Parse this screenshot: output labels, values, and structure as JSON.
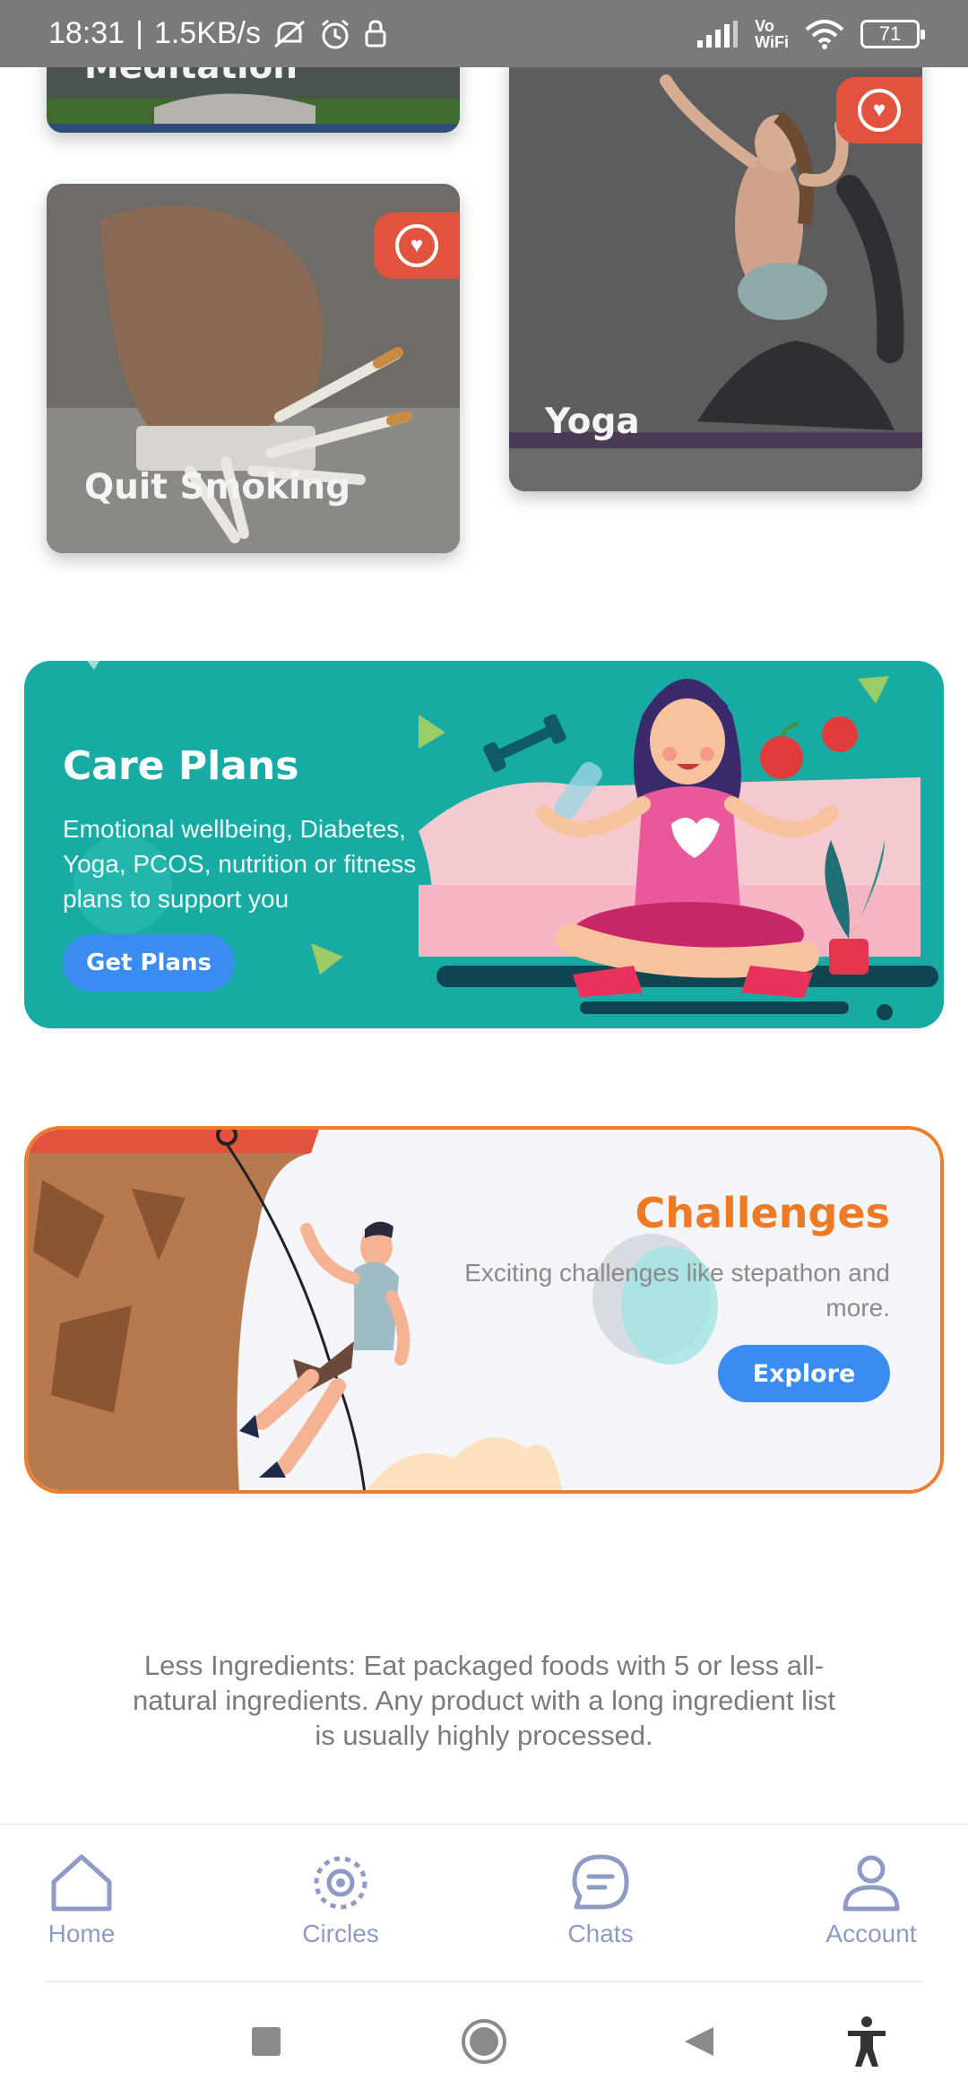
{
  "status_bar": {
    "time": "18:31",
    "net_speed": "1.5KB/s",
    "vowifi_top": "Vo",
    "vowifi_bottom": "WiFi",
    "battery": "71"
  },
  "cards": [
    {
      "label": "Meditation",
      "liked": true
    },
    {
      "label": "Quit Smoking",
      "liked": true
    },
    {
      "label": "Yoga",
      "liked": true
    }
  ],
  "care_plans": {
    "title": "Care Plans",
    "description": "Emotional wellbeing, Diabetes, Yoga, PCOS, nutrition or fitness plans to support you",
    "button": "Get Plans",
    "color": "#17aba4"
  },
  "challenges": {
    "title": "Challenges",
    "description": "Exciting challenges like stepathon and more.",
    "button": "Explore",
    "accent": "#ef7d2d"
  },
  "tip": "Less Ingredients: Eat packaged foods with 5 or less all-natural ingredients. Any product with a long ingredient list is usually highly processed.",
  "bottom_nav": [
    {
      "label": "Home",
      "icon": "home-icon"
    },
    {
      "label": "Circles",
      "icon": "circles-icon"
    },
    {
      "label": "Chats",
      "icon": "chat-icon"
    },
    {
      "label": "Account",
      "icon": "account-icon"
    }
  ],
  "system_nav": [
    "recents-icon",
    "home-circle-icon",
    "back-icon",
    "accessibility-icon"
  ]
}
